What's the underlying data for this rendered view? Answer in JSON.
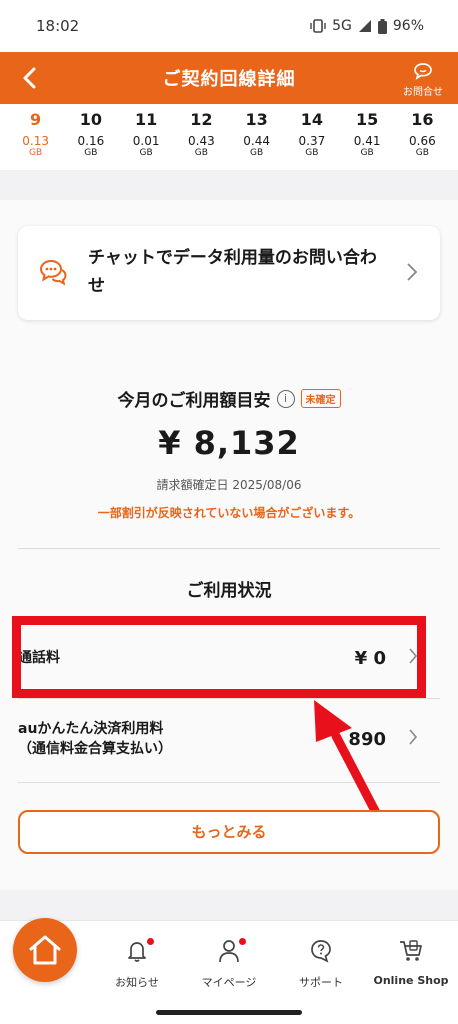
{
  "status_bar": {
    "time": "18:02",
    "network": "5G",
    "battery": "96%"
  },
  "header": {
    "title": "ご契約回線詳細",
    "contact_label": "お問合せ"
  },
  "days": [
    {
      "day": "9",
      "value": "0.13",
      "unit": "GB",
      "active": true
    },
    {
      "day": "10",
      "value": "0.16",
      "unit": "GB"
    },
    {
      "day": "11",
      "value": "0.01",
      "unit": "GB"
    },
    {
      "day": "12",
      "value": "0.43",
      "unit": "GB"
    },
    {
      "day": "13",
      "value": "0.44",
      "unit": "GB"
    },
    {
      "day": "14",
      "value": "0.37",
      "unit": "GB"
    },
    {
      "day": "15",
      "value": "0.41",
      "unit": "GB"
    },
    {
      "day": "16",
      "value": "0.66",
      "unit": "GB"
    }
  ],
  "chat_card": {
    "text": "チャットでデータ利用量のお問い合わせ"
  },
  "fees": {
    "title": "今月のご利用額目安",
    "badge": "未確定",
    "amount": "¥ 8,132",
    "confirm_date": "請求額確定日 2025/08/06",
    "notice": "一部割引が反映されていない場合がございます。"
  },
  "usage": {
    "title": "ご利用状況",
    "rows": [
      {
        "label": "通話料",
        "value": "¥ 0"
      },
      {
        "label_line1": "auかんたん決済利用料",
        "label_line2": "（通信料金合算支払い）",
        "value": "890"
      }
    ],
    "more_label": "もっとみる"
  },
  "tabs": [
    {
      "label": "お知らせ"
    },
    {
      "label": "マイページ"
    },
    {
      "label": "サポート"
    },
    {
      "label": "Online Shop"
    }
  ],
  "colors": {
    "accent": "#e8651a",
    "highlight": "#e8101a"
  }
}
